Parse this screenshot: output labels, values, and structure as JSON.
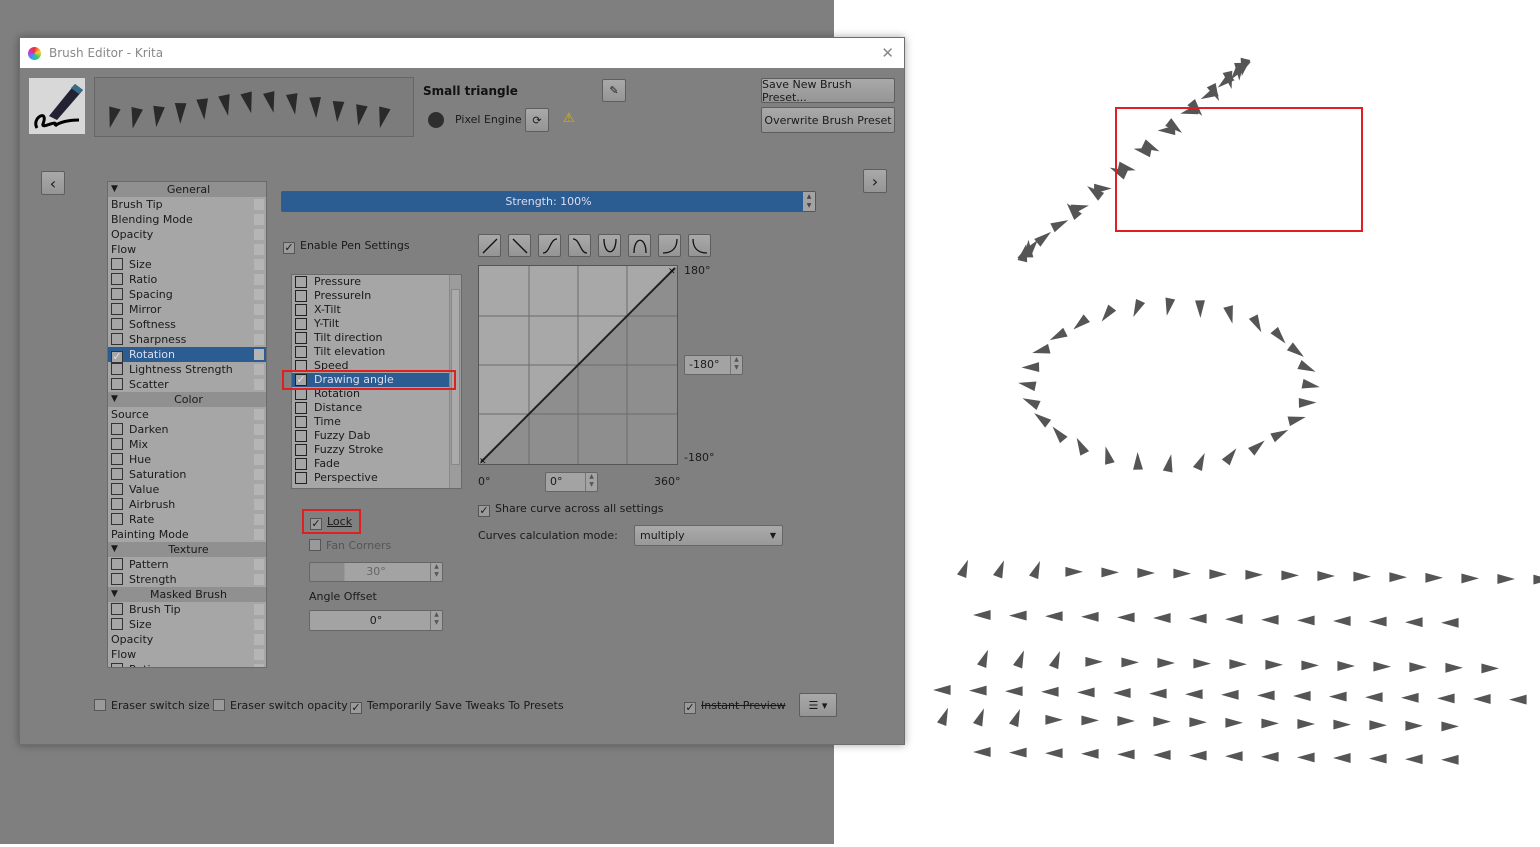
{
  "window": {
    "title": "Brush Editor - Krita",
    "close": "✕"
  },
  "preset": {
    "name": "Small triangle",
    "engine": "Pixel Engine",
    "save_new": "Save New Brush Preset...",
    "overwrite": "Overwrite Brush Preset"
  },
  "nav": {
    "prev": "‹",
    "next": "›"
  },
  "strength": {
    "label": "Strength: 100%",
    "value": 100
  },
  "settings_list": [
    {
      "type": "header",
      "label": "General"
    },
    {
      "label": "Brush Tip"
    },
    {
      "label": "Blending Mode"
    },
    {
      "label": "Opacity"
    },
    {
      "label": "Flow"
    },
    {
      "label": "Size",
      "cb": false
    },
    {
      "label": "Ratio",
      "cb": false
    },
    {
      "label": "Spacing",
      "cb": false
    },
    {
      "label": "Mirror",
      "cb": false
    },
    {
      "label": "Softness",
      "cb": false
    },
    {
      "label": "Sharpness",
      "cb": false
    },
    {
      "label": "Rotation",
      "cb": true,
      "selected": true
    },
    {
      "label": "Lightness Strength",
      "cb": false
    },
    {
      "label": "Scatter",
      "cb": false
    },
    {
      "type": "header",
      "label": "Color"
    },
    {
      "label": "Source"
    },
    {
      "label": "Darken",
      "cb": false
    },
    {
      "label": "Mix",
      "cb": false
    },
    {
      "label": "Hue",
      "cb": false
    },
    {
      "label": "Saturation",
      "cb": false
    },
    {
      "label": "Value",
      "cb": false
    },
    {
      "label": "Airbrush",
      "cb": false
    },
    {
      "label": "Rate",
      "cb": false
    },
    {
      "label": "Painting Mode"
    },
    {
      "type": "header",
      "label": "Texture"
    },
    {
      "label": "Pattern",
      "cb": false
    },
    {
      "label": "Strength",
      "cb": false
    },
    {
      "type": "header",
      "label": "Masked Brush"
    },
    {
      "label": "Brush Tip",
      "cb": false
    },
    {
      "label": "Size",
      "cb": false
    },
    {
      "label": "Opacity"
    },
    {
      "label": "Flow"
    },
    {
      "label": "Ratio",
      "cb": false
    }
  ],
  "pen": {
    "enable_label": "Enable Pen Settings",
    "enabled": true,
    "sensors": [
      {
        "label": "Pressure"
      },
      {
        "label": "PressureIn"
      },
      {
        "label": "X-Tilt"
      },
      {
        "label": "Y-Tilt"
      },
      {
        "label": "Tilt direction"
      },
      {
        "label": "Tilt elevation"
      },
      {
        "label": "Speed"
      },
      {
        "label": "Drawing angle",
        "checked": true,
        "selected": true
      },
      {
        "label": "Rotation"
      },
      {
        "label": "Distance"
      },
      {
        "label": "Time"
      },
      {
        "label": "Fuzzy Dab"
      },
      {
        "label": "Fuzzy Stroke"
      },
      {
        "label": "Fade"
      },
      {
        "label": "Perspective"
      }
    ],
    "lock_label": "Lock",
    "lock": true,
    "fan_label": "Fan Corners",
    "fan": false,
    "fan_value": "30°",
    "angle_offset_label": "Angle Offset",
    "angle_offset": "0°"
  },
  "curve": {
    "y_max": "180°",
    "y_min": "-180°",
    "y_value": "-180°",
    "x_min": "0°",
    "x_max": "360°",
    "x_value": "0°",
    "share_label": "Share curve across all settings",
    "share": true,
    "mode_label": "Curves calculation mode:",
    "mode": "multiply"
  },
  "bottom": {
    "eraser_size": "Eraser switch size",
    "eraser_opacity": "Eraser switch opacity",
    "temp_save": "Temporarily Save Tweaks To Presets",
    "instant_preview": "Instant Preview"
  },
  "check": "✓"
}
